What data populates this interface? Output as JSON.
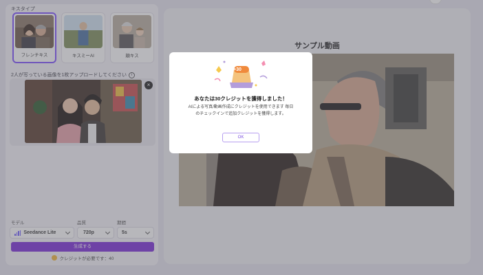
{
  "left": {
    "style_section_title": "キスタイプ",
    "styles": [
      {
        "label": "フレンチキス",
        "selected": true
      },
      {
        "label": "キスミーAI",
        "selected": false
      },
      {
        "label": "頬キス",
        "selected": false
      }
    ],
    "upload_hint": "2人が写っている画像を1枚アップロードしてください",
    "info_icon": "info-icon",
    "remove_icon": "close-icon"
  },
  "controls": {
    "model_label": "モデル",
    "model_value": "Seedance Lite",
    "quality_label": "品質",
    "quality_value": "720p",
    "duration_label": "期間",
    "duration_value": "5s",
    "generate_label": "生成する",
    "credits_note": "クレジットが必要です：40"
  },
  "right": {
    "sample_title": "サンプル動画"
  },
  "modal": {
    "badge": "+30",
    "title": "あなたは30クレジットを獲得しました！",
    "body": "AIによる写真/動画作成にクレジットを使用できます 毎日のチェックインで追加クレジットを獲得します。",
    "ok_label": "OK"
  },
  "colors": {
    "accent": "#7a2bd9",
    "selection_border": "#7c4dff",
    "ok_border": "#b69ef0"
  }
}
